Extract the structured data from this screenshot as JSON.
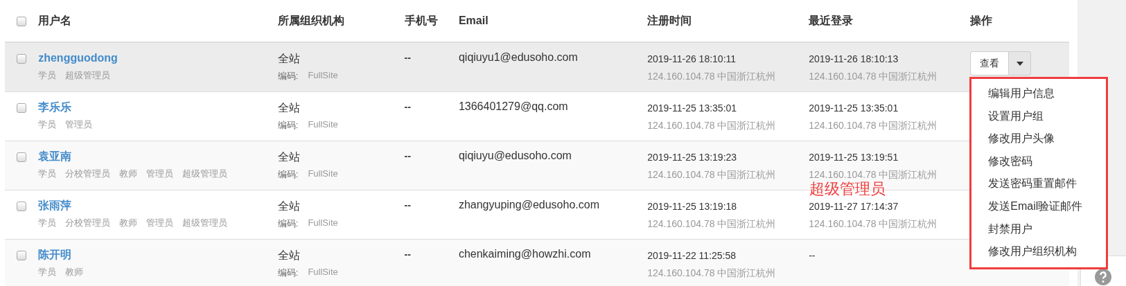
{
  "table": {
    "select_all": {
      "checked": false
    },
    "columns": [
      "用户名",
      "所属组织机构",
      "手机号",
      "Email",
      "注册时间",
      "最近登录",
      "操作"
    ],
    "rows": [
      {
        "checked": false,
        "highlighted": true,
        "username": "zhengguodong",
        "roles": [
          "学员",
          "超级管理员"
        ],
        "org": "全站",
        "org_code_label": "编码:",
        "org_code": "FullSite",
        "phone": "--",
        "email": "qiqiuyu1@edusoho.com",
        "registered": "2019-11-26 18:10:11",
        "registered_ip": "124.160.104.78 中国浙江杭州",
        "last_login": "2019-11-26 18:10:13",
        "last_login_ip": "124.160.104.78 中国浙江杭州",
        "view_button": "查看"
      },
      {
        "checked": false,
        "highlighted": false,
        "username": "李乐乐",
        "roles": [
          "学员",
          "管理员"
        ],
        "org": "全站",
        "org_code_label": "编码:",
        "org_code": "FullSite",
        "phone": "--",
        "email": "1366401279@qq.com",
        "registered": "2019-11-25 13:35:01",
        "registered_ip": "124.160.104.78 中国浙江杭州",
        "last_login": "2019-11-25 13:35:01",
        "last_login_ip": "124.160.104.78 中国浙江杭州"
      },
      {
        "checked": false,
        "highlighted": false,
        "username": "袁亚南",
        "roles": [
          "学员",
          "分校管理员",
          "教师",
          "管理员",
          "超级管理员"
        ],
        "org": "全站",
        "org_code_label": "编码:",
        "org_code": "FullSite",
        "phone": "--",
        "email": "qiqiuyu@edusoho.com",
        "registered": "2019-11-25 13:19:23",
        "registered_ip": "124.160.104.78 中国浙江杭州",
        "last_login": "2019-11-25 13:19:51",
        "last_login_ip": "124.160.104.78 中国浙江杭州"
      },
      {
        "checked": false,
        "highlighted": false,
        "username": "张雨萍",
        "roles": [
          "学员",
          "分校管理员",
          "教师",
          "管理员",
          "超级管理员"
        ],
        "org": "全站",
        "org_code_label": "编码:",
        "org_code": "FullSite",
        "phone": "--",
        "email": "zhangyuping@edusoho.com",
        "registered": "2019-11-25 13:19:18",
        "registered_ip": "124.160.104.78 中国浙江杭州",
        "last_login": "2019-11-27 17:14:37",
        "last_login_ip": "124.160.104.78 中国浙江杭州"
      },
      {
        "checked": false,
        "highlighted": false,
        "username": "陈开明",
        "roles": [
          "学员",
          "教师"
        ],
        "org": "全站",
        "org_code_label": "编码:",
        "org_code": "FullSite",
        "phone": "--",
        "email": "chenkaiming@howzhi.com",
        "registered": "2019-11-22 11:25:58",
        "registered_ip": "124.160.104.78 中国浙江杭州",
        "last_login": "--"
      }
    ]
  },
  "dropdown_menu": {
    "items": [
      "编辑用户信息",
      "设置用户组",
      "修改用户头像",
      "修改密码",
      "发送密码重置邮件",
      "发送Email验证邮件",
      "封禁用户",
      "修改用户组织机构"
    ]
  },
  "annotation": {
    "text": "超级管理员"
  }
}
